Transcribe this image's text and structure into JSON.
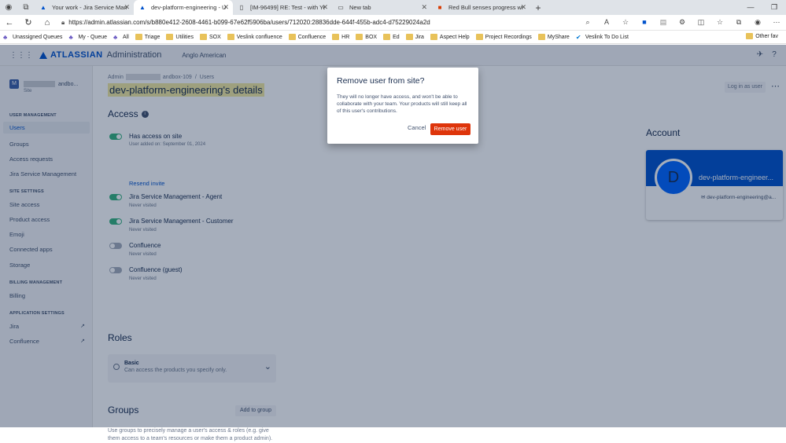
{
  "browser": {
    "tabs": [
      {
        "label": "Your work - Jira Service Managem"
      },
      {
        "label": "dev-platform-engineering - Users"
      },
      {
        "label": "[IM-96499] RE: Test - with Yes sec"
      },
      {
        "label": "New tab"
      },
      {
        "label": "Red Bull senses progress with its"
      }
    ],
    "url": "https://admin.atlassian.com/s/b880e412-2608-4461-b099-67e62f5906ba/users/712020:28836dde-644f-455b-adc4-d75229024a2d",
    "bookmarks": [
      "Unassigned Queues",
      "My - Queue",
      "All",
      "Triage",
      "Utilities",
      "SOX",
      "Veslink confluence",
      "Confluence",
      "HR",
      "BOX",
      "Ed",
      "Jira",
      "Aspect Help",
      "Project Recordings",
      "MyShare",
      "Veslink To Do List"
    ],
    "other_bookmarks": "Other fav"
  },
  "topnav": {
    "brand": "ATLASSIAN",
    "product": "Administration",
    "org": "Anglo American"
  },
  "sidebar": {
    "site_name": "andbo...",
    "site_sub": "Site",
    "sections": {
      "user_mgmt": "USER MANAGEMENT",
      "site_settings": "SITE SETTINGS",
      "billing_mgmt": "BILLING MANAGEMENT",
      "app_settings": "APPLICATION SETTINGS"
    },
    "items": {
      "users": "Users",
      "groups": "Groups",
      "access_requests": "Access requests",
      "jsm": "Jira Service Management",
      "site_access": "Site access",
      "product_access": "Product access",
      "emoji": "Emoji",
      "connected_apps": "Connected apps",
      "storage": "Storage",
      "billing": "Billing",
      "jira": "Jira",
      "confluence": "Confluence"
    }
  },
  "main": {
    "breadcrumb": {
      "admin": "Admin",
      "sep": "/",
      "site": "andbox-109",
      "users": "Users"
    },
    "title": "dev-platform-engineering's details",
    "login_as_user": "Log in as user",
    "access_heading": "Access",
    "has_access": "Has access on site",
    "user_added": "User added on: September 01, 2024",
    "resend_invite": "Resend invite",
    "products": [
      {
        "name": "Jira Service Management - Agent",
        "status": "Never visited",
        "enabled": true
      },
      {
        "name": "Jira Service Management - Customer",
        "status": "Never visited",
        "enabled": true
      },
      {
        "name": "Confluence",
        "status": "Never visited",
        "enabled": false
      },
      {
        "name": "Confluence (guest)",
        "status": "Never visited",
        "enabled": false
      }
    ],
    "roles_heading": "Roles",
    "role_name": "Basic",
    "role_desc": "Can access the products you specify only.",
    "groups_heading": "Groups",
    "add_to_group": "Add to group",
    "groups_desc": "Use groups to precisely manage a user's access & roles (e.g. give them access to a team's resources or make them a product admin).",
    "account_heading": "Account",
    "account_initial": "D",
    "account_name": "dev-platform-engineer...",
    "account_email": "dev-platform-engineering@a..."
  },
  "dialog": {
    "title": "Remove user from site?",
    "body": "They will no longer have access, and won't be able to collaborate with your team. Your products will still keep all of this user's contributions.",
    "cancel": "Cancel",
    "remove": "Remove user"
  },
  "colors": {
    "accent": "#0052cc",
    "danger": "#de350b",
    "success": "#36b37e"
  }
}
